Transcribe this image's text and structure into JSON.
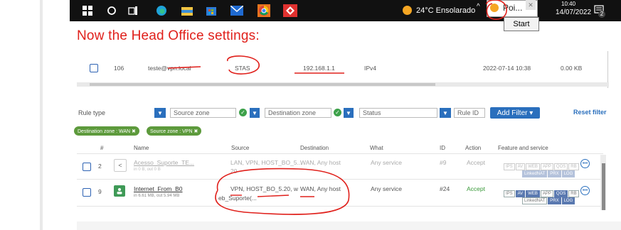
{
  "taskbar": {
    "weather": "24°C  Ensolarado",
    "popup_text": "Poi...",
    "time": "10:40",
    "date": "14/07/2022",
    "notification_count": "2",
    "start_tooltip": "Start"
  },
  "heading": "Now the Head Office settings:",
  "top_row": {
    "id": "106",
    "user": "teste@vpn.local",
    "method": "STAS",
    "ip": "192.168.1.1",
    "version": "IPv4",
    "timestamp": "2022-07-14 10:38",
    "data": "0.00 KB"
  },
  "filters": {
    "rule_type": "Rule type",
    "source_zone": "Source zone",
    "destination_zone": "Destination zone",
    "status": "Status",
    "rule_id": "Rule ID",
    "add_filter": "Add Filter",
    "reset_filter": "Reset filter",
    "chips": [
      "Destination zone : WAN ✖",
      "Source zone : VPN ✖"
    ]
  },
  "columns": [
    "#",
    "Name",
    "Source",
    "Destination",
    "What",
    "ID",
    "Action",
    "Feature and service"
  ],
  "rows": [
    {
      "num": "2",
      "name": "Acesso_Suporte_TE...",
      "traffic": "in 0 B, out 0 B",
      "source": "LAN, VPN, HOST_BO_5...",
      "source2": "20",
      "destination": "WAN, Any host",
      "what": "Any service",
      "id": "#9",
      "action": "Accept",
      "features": [
        "IPS",
        "AV",
        "WEB",
        "APP",
        "QOS",
        "RB"
      ],
      "features2": [
        "LinkedNAT",
        "PRX",
        "LOG"
      ]
    },
    {
      "num": "9",
      "name": "Internet_From_B0",
      "traffic": "in 6.61 MB, out 5.94 MB",
      "source": "VPN, HOST_BO_5.20, w",
      "source2": "eb_Suporte(...",
      "destination": "WAN, Any host",
      "what": "Any service",
      "id": "#24",
      "action": "Accept",
      "features": [
        "IPS",
        "AV",
        "WEB",
        "APP",
        "QOS",
        "RB"
      ],
      "features2": [
        "LinkedNAT",
        "PRX",
        "LOG"
      ]
    }
  ],
  "colors": {
    "accent": "#2a6fbd",
    "heading": "#e0201b",
    "accept": "#3a9a3a",
    "annotation": "#e0201b"
  },
  "icons": [
    "windows-icon",
    "search-icon",
    "task-view-icon",
    "edge-icon",
    "file-explorer-icon",
    "store-icon",
    "mail-icon",
    "chrome-icon",
    "anydesk-icon",
    "notification-icon"
  ]
}
